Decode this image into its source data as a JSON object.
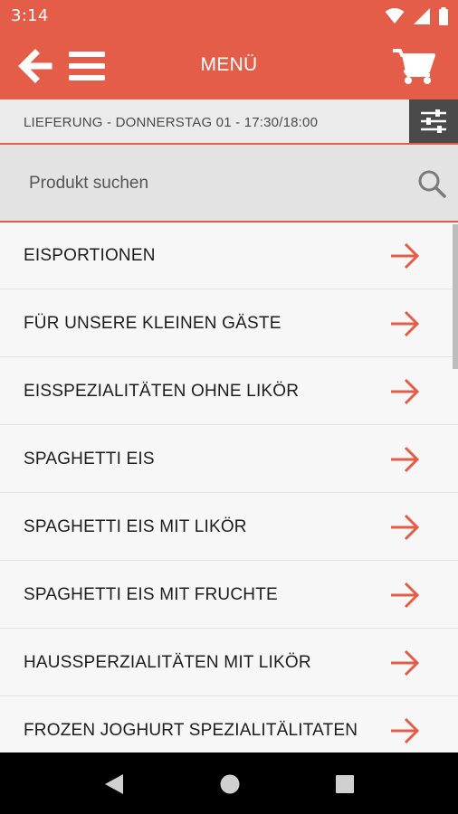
{
  "status_bar": {
    "time": "3:14",
    "icons": [
      "wifi-icon",
      "cell-signal-icon",
      "battery-icon"
    ]
  },
  "app_bar": {
    "title": "MENÜ",
    "back_icon": "arrow-left-icon",
    "menu_icon": "hamburger-icon",
    "cart_icon": "cart-icon",
    "color": "#e35d48"
  },
  "delivery": {
    "text": "LIEFERUNG - DONNERSTAG 01 - 17:30/18:00",
    "filter_icon": "sliders-icon"
  },
  "search": {
    "placeholder": "Produkt suchen",
    "icon": "search-icon"
  },
  "menu": {
    "items": [
      {
        "label": "EISPORTIONEN"
      },
      {
        "label": "FÜR UNSERE KLEINEN GÄSTE"
      },
      {
        "label": "EISSPEZIALITÄTEN OHNE LIKÖR"
      },
      {
        "label": "SPAGHETTI EIS"
      },
      {
        "label": "SPAGHETTI EIS MIT LIKÖR"
      },
      {
        "label": "SPAGHETTI EIS MIT FRUCHTE"
      },
      {
        "label": "HAUSSPERZIALITÄTEN MIT LIKÖR"
      },
      {
        "label": "FROZEN JOGHURT SPEZIALITÄLITATEN"
      }
    ],
    "arrow_icon": "arrow-right-icon",
    "accent": "#e35d48"
  },
  "nav_bar": {
    "buttons": [
      "back-triangle-icon",
      "home-circle-icon",
      "recents-square-icon"
    ]
  }
}
